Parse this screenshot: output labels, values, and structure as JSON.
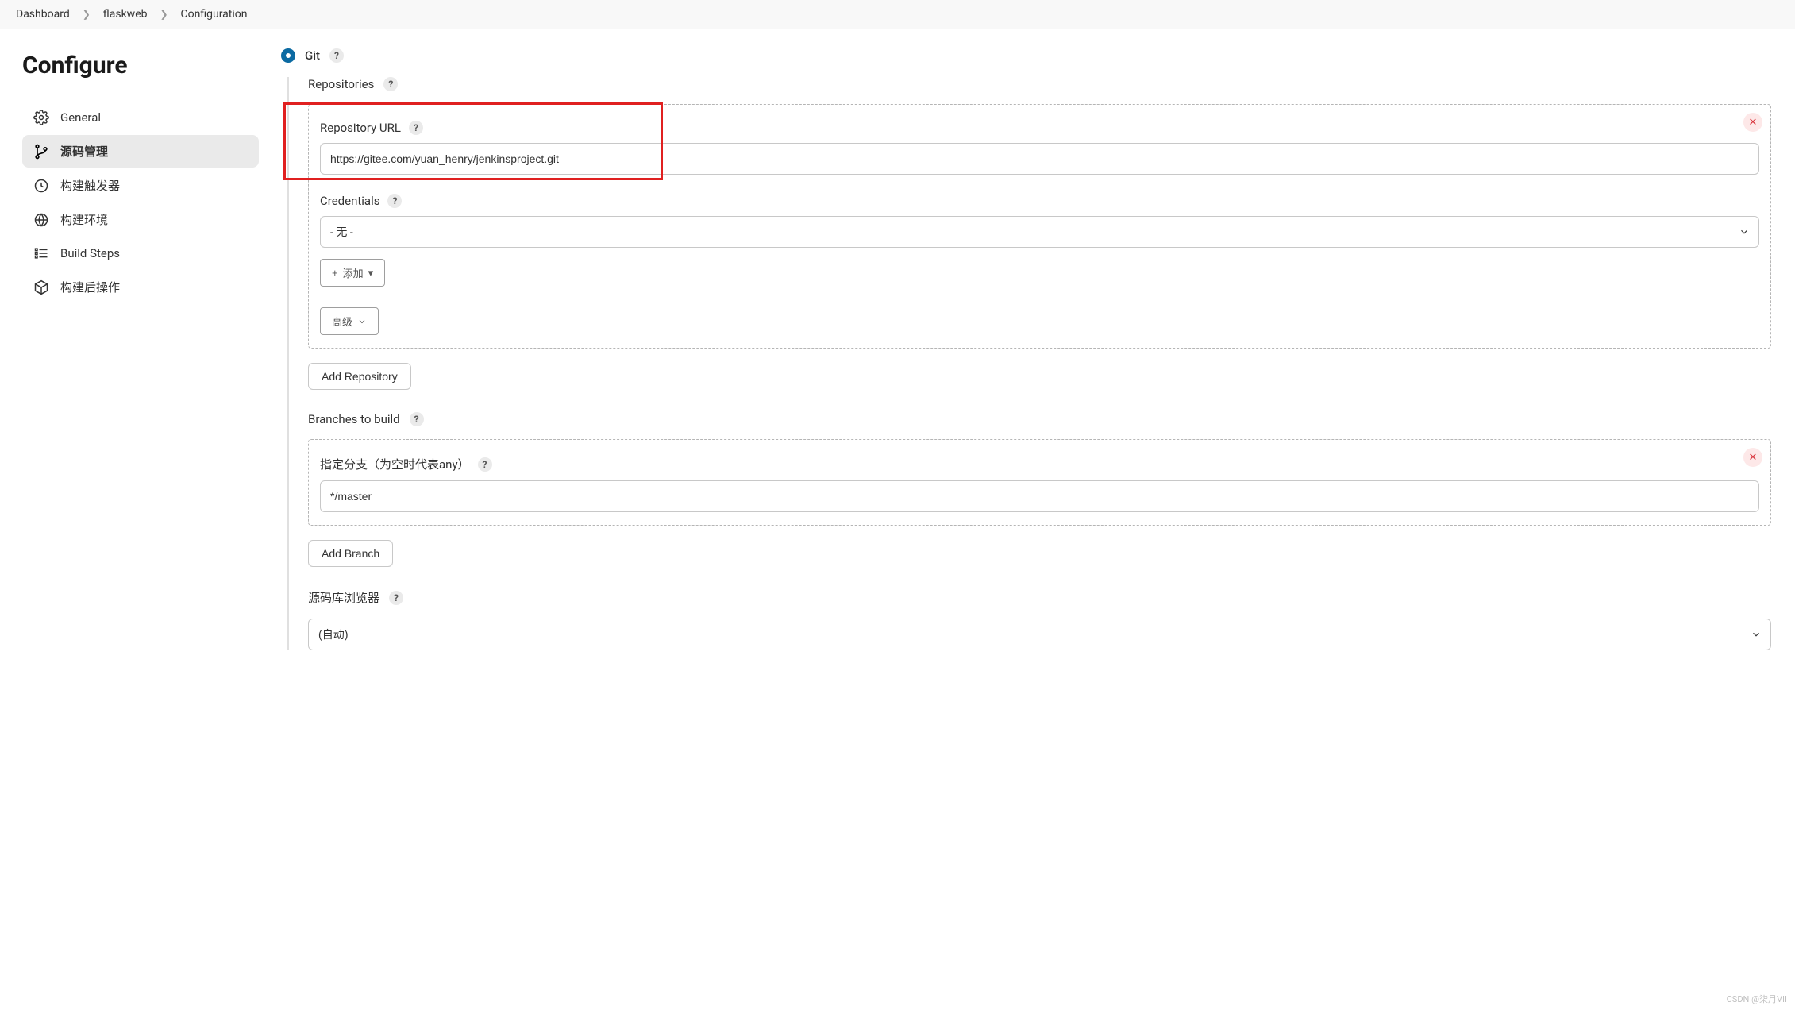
{
  "breadcrumb": {
    "items": [
      "Dashboard",
      "flaskweb",
      "Configuration"
    ]
  },
  "sidebar": {
    "title": "Configure",
    "items": [
      {
        "label": "General",
        "active": false
      },
      {
        "label": "源码管理",
        "active": true
      },
      {
        "label": "构建触发器",
        "active": false
      },
      {
        "label": "构建环境",
        "active": false
      },
      {
        "label": "Build Steps",
        "active": false
      },
      {
        "label": "构建后操作",
        "active": false
      }
    ]
  },
  "main": {
    "git_label": "Git",
    "repositories_label": "Repositories",
    "repo_url_label": "Repository URL",
    "repo_url_value": "https://gitee.com/yuan_henry/jenkinsproject.git",
    "credentials_label": "Credentials",
    "credentials_value": "- 无 -",
    "add_cred_label": "添加",
    "advanced_label": "高级",
    "add_repository_label": "Add Repository",
    "branches_label": "Branches to build",
    "branch_spec_label": "指定分支（为空时代表any）",
    "branch_spec_value": "*/master",
    "add_branch_label": "Add Branch",
    "repo_browser_label": "源码库浏览器",
    "repo_browser_value": "(自动)"
  },
  "watermark": "CSDN @柒月VII"
}
